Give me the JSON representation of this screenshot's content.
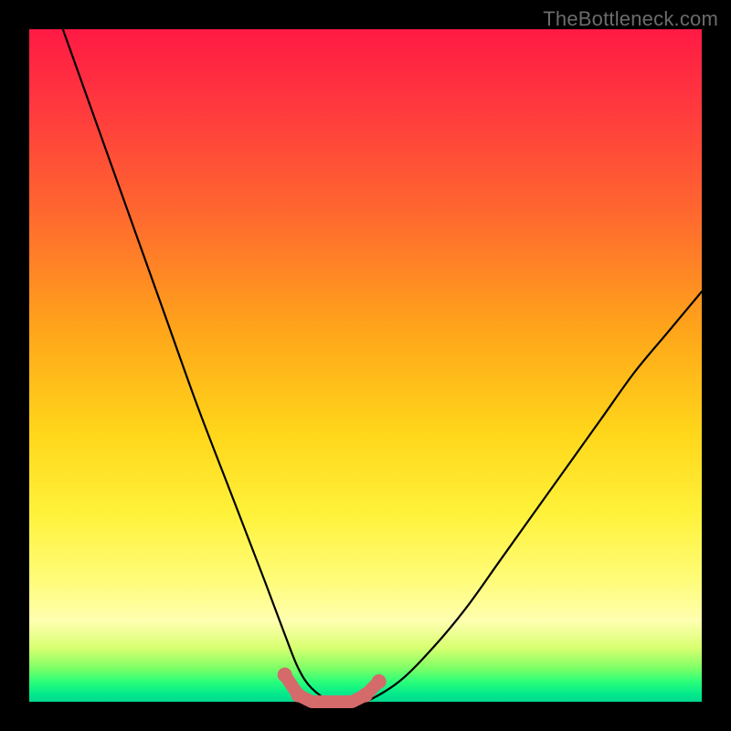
{
  "watermark": "TheBottleneck.com",
  "chart_data": {
    "type": "line",
    "title": "",
    "xlabel": "",
    "ylabel": "",
    "xlim": [
      0,
      100
    ],
    "ylim": [
      0,
      100
    ],
    "grid": false,
    "legend": false,
    "annotations": [],
    "series": [
      {
        "name": "bottleneck-curve",
        "color": "#000000",
        "x": [
          5,
          10,
          15,
          20,
          25,
          30,
          35,
          38,
          40,
          42,
          45,
          48,
          50,
          55,
          60,
          65,
          70,
          75,
          80,
          85,
          90,
          95,
          100
        ],
        "y": [
          100,
          86,
          72,
          58,
          44,
          31,
          18,
          10,
          5,
          2,
          0,
          0,
          0,
          3,
          8,
          14,
          21,
          28,
          35,
          42,
          49,
          55,
          61
        ]
      },
      {
        "name": "valley-marker",
        "color": "#d46a6a",
        "x": [
          38,
          40,
          42,
          44,
          46,
          48,
          50,
          52
        ],
        "y": [
          4,
          1,
          0,
          0,
          0,
          0,
          1,
          3
        ]
      }
    ]
  },
  "colors": {
    "frame": "#000000",
    "curve": "#000000",
    "marker": "#d46a6a",
    "watermark": "#6b6b6b"
  }
}
